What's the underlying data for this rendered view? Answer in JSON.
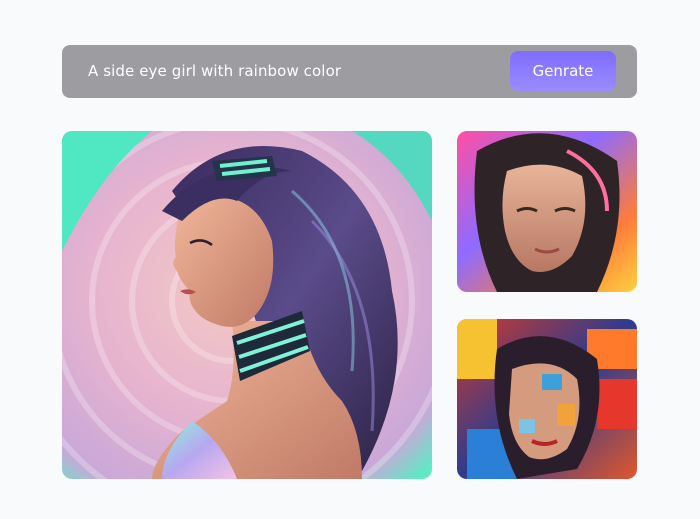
{
  "prompt": {
    "value": "A side eye girl with rainbow color"
  },
  "generate_button": {
    "label": "Genrate"
  },
  "colors": {
    "prompt_bar_bg": "#9d9ca1",
    "button_gradient_top": "#7f6cff",
    "button_gradient_bottom": "#9a8cff",
    "page_bg": "#f9fafb"
  },
  "images": [
    {
      "role": "main-result",
      "depiction": "side profile portrait"
    },
    {
      "role": "thumbnail",
      "depiction": "frontal portrait"
    },
    {
      "role": "thumbnail",
      "depiction": "abstract painted portrait"
    }
  ]
}
